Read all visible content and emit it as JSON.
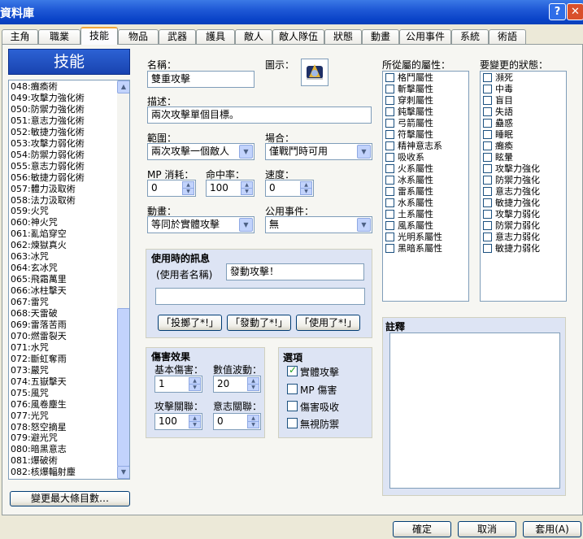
{
  "window": {
    "title": "資料庫",
    "help_label": "?",
    "close_label": "✕"
  },
  "tabs": [
    "主角",
    "職業",
    "技能",
    "物品",
    "武器",
    "護具",
    "敵人",
    "敵人隊伍",
    "狀態",
    "動畫",
    "公用事件",
    "系統",
    "術語"
  ],
  "active_tab": "技能",
  "sidebar": {
    "header": "技能",
    "items": [
      "048:癱瘓術",
      "049:攻擊力強化術",
      "050:防禦力強化術",
      "051:意志力強化術",
      "052:敏捷力強化術",
      "053:攻擊力弱化術",
      "054:防禦力弱化術",
      "055:意志力弱化術",
      "056:敏捷力弱化術",
      "057:體力汲取術",
      "058:法力汲取術",
      "059:火咒",
      "060:神火咒",
      "061:亂焰穿空",
      "062:煉獄真火",
      "063:冰咒",
      "064:玄冰咒",
      "065:飛霜萬里",
      "066:冰柱擊天",
      "067:雷咒",
      "068:天雷破",
      "069:雷落苦雨",
      "070:燃雷裂天",
      "071:水咒",
      "072:斷虹奪雨",
      "073:嚴咒",
      "074:五嶽擊天",
      "075:風咒",
      "076:風卷塵生",
      "077:光咒",
      "078:怒空摘星",
      "079:避光咒",
      "080:暗黑意志",
      "081:爆破術",
      "082:核爆輻射塵"
    ],
    "change_max_button": "變更最大條目數…"
  },
  "form": {
    "name_label": "名稱：",
    "name_value": "雙重攻擊",
    "icon_label": "圖示：",
    "desc_label": "描述：",
    "desc_value": "兩次攻擊單個目標。",
    "scope_label": "範圍：",
    "scope_value": "兩次攻擊一個敵人",
    "occasion_label": "場合：",
    "occasion_value": "僅戰鬥時可用",
    "mp_label": "MP 消耗：",
    "mp_value": "0",
    "hit_label": "命中率：",
    "hit_value": "100",
    "speed_label": "速度：",
    "speed_value": "0",
    "anim_label": "動畫：",
    "anim_value": "等同於實體攻擊",
    "common_event_label": "公用事件：",
    "common_event_value": "無"
  },
  "message": {
    "title": "使用時的訊息",
    "user_label": "(使用者名稱)",
    "line1": "發動攻擊！",
    "line2": "",
    "buttons": [
      "「投擲了*!」",
      "「發動了*!」",
      "「使用了*!」"
    ]
  },
  "damage": {
    "title": "傷害效果",
    "base_label": "基本傷害：",
    "base_value": "1",
    "variance_label": "數值波動：",
    "variance_value": "20",
    "atk_label": "攻擊關聯：",
    "atk_value": "100",
    "int_label": "意志關聯：",
    "int_value": "0"
  },
  "options": {
    "title": "選項",
    "items": [
      {
        "label": "實體攻擊",
        "checked": true
      },
      {
        "label": "MP 傷害",
        "checked": false
      },
      {
        "label": "傷害吸收",
        "checked": false
      },
      {
        "label": "無視防禦",
        "checked": false
      }
    ]
  },
  "elements": {
    "title": "所從屬的屬性：",
    "items": [
      "格鬥屬性",
      "斬擊屬性",
      "穿刺屬性",
      "鈍擊屬性",
      "弓箭屬性",
      "符擊屬性",
      "精神意志系",
      "吸收系",
      "火系屬性",
      "冰系屬性",
      "雷系屬性",
      "水系屬性",
      "土系屬性",
      "風系屬性",
      "光明系屬性",
      "黑暗系屬性"
    ]
  },
  "states": {
    "title": "要變更的狀態：",
    "items": [
      "瀕死",
      "中毒",
      "盲目",
      "失語",
      "蠱惑",
      "睡眠",
      "癱瘓",
      "眩暈",
      "攻擊力強化",
      "防禦力強化",
      "意志力強化",
      "敏捷力強化",
      "攻擊力弱化",
      "防禦力弱化",
      "意志力弱化",
      "敏捷力弱化"
    ]
  },
  "notes": {
    "title": "註釋",
    "value": ""
  },
  "bottom": {
    "ok": "確定",
    "cancel": "取消",
    "apply": "套用(A)"
  }
}
